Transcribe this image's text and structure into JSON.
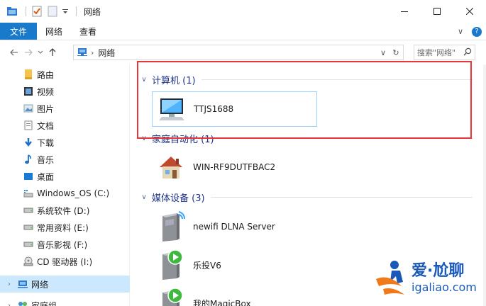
{
  "window": {
    "title": "网络",
    "controls": {
      "minimize": "—",
      "maximize": "☐",
      "close": "✕"
    }
  },
  "ribbon": {
    "tabs": [
      {
        "label": "文件",
        "active": true
      },
      {
        "label": "网络"
      },
      {
        "label": "查看"
      }
    ],
    "expand_glyph": "∨",
    "help_glyph": "?"
  },
  "address": {
    "path": "网络",
    "refresh_glyph": "↻",
    "search_placeholder": "搜索\"网络\""
  },
  "nav": {
    "items": [
      {
        "label": "路由",
        "icon": "router-folder-icon"
      },
      {
        "label": "视频",
        "icon": "videos-icon"
      },
      {
        "label": "图片",
        "icon": "pictures-icon"
      },
      {
        "label": "文档",
        "icon": "documents-icon"
      },
      {
        "label": "下载",
        "icon": "downloads-icon"
      },
      {
        "label": "音乐",
        "icon": "music-icon"
      },
      {
        "label": "桌面",
        "icon": "desktop-icon"
      },
      {
        "label": "Windows_OS (C:)",
        "icon": "system-drive-icon"
      },
      {
        "label": "系统软件 (D:)",
        "icon": "drive-icon"
      },
      {
        "label": "常用资料 (E:)",
        "icon": "drive-icon"
      },
      {
        "label": "音乐影视 (F:)",
        "icon": "drive-icon"
      },
      {
        "label": "CD 驱动器 (I:)",
        "icon": "cd-drive-icon"
      },
      {
        "label": "网络",
        "icon": "network-icon",
        "selected": true
      },
      {
        "label": "家庭组",
        "icon": "homegroup-icon"
      }
    ]
  },
  "content": {
    "groups": [
      {
        "title": "计算机 (1)",
        "items": [
          {
            "name": "TTJS1688",
            "icon": "computer-icon"
          }
        ]
      },
      {
        "title": "家庭自动化 (1)",
        "items": [
          {
            "name": "WIN-RF9DUTFBAC2",
            "icon": "home-device-icon"
          }
        ]
      },
      {
        "title": "媒体设备 (3)",
        "items": [
          {
            "name": "newifi DLNA Server",
            "icon": "media-server-icon"
          },
          {
            "name": "乐投V6",
            "icon": "media-player-icon"
          },
          {
            "name": "我的MagicBox",
            "icon": "media-player-icon"
          }
        ]
      }
    ]
  },
  "watermark": {
    "top": "爱·尬聊",
    "bottom": "igaliao.com"
  },
  "colors": {
    "accent": "#1979ca",
    "highlight": "#e8353a",
    "group_title": "#1e3287",
    "selection": "#cce8ff"
  }
}
